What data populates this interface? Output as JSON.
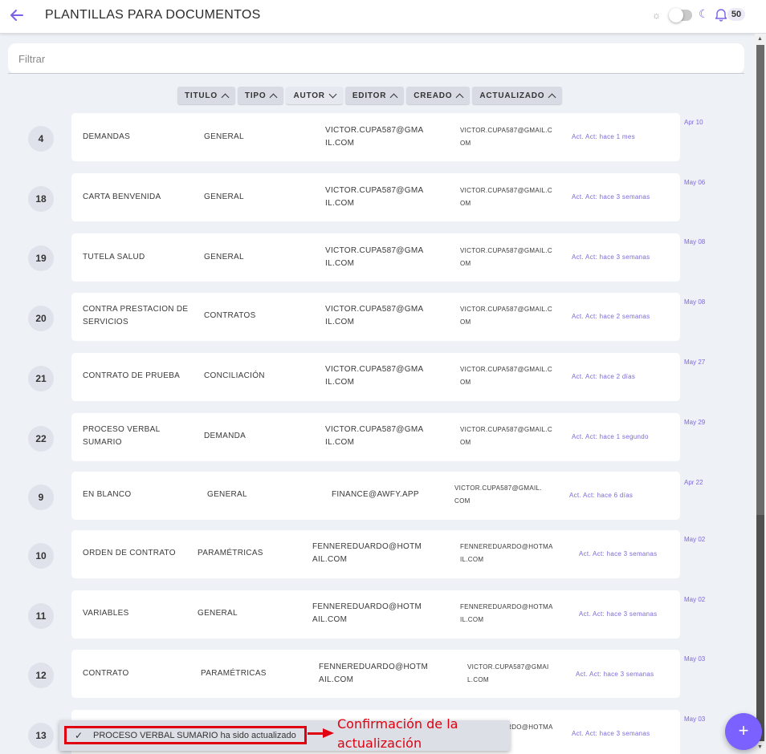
{
  "header": {
    "title": "PLANTILLAS PARA DOCUMENTOS",
    "notifications_count": "50"
  },
  "filter": {
    "placeholder": "Filtrar"
  },
  "sort_chips": [
    {
      "label": "TITULO",
      "direction": "up"
    },
    {
      "label": "TIPO",
      "direction": "up"
    },
    {
      "label": "AUTOR",
      "direction": "down"
    },
    {
      "label": "EDITOR",
      "direction": "up"
    },
    {
      "label": "CREADO",
      "direction": "up"
    },
    {
      "label": "ACTUALIZADO",
      "direction": "up"
    }
  ],
  "rows": [
    {
      "num": "4",
      "title": "DEMANDAS",
      "tipo": "GENERAL",
      "autor": "VICTOR.CUPA587@GMAIL.COM",
      "editor": "VICTOR.CUPA587@GMAIL.COM",
      "actualizado": "Act. Act: hace 1 mes",
      "creado": "Apr 10"
    },
    {
      "num": "18",
      "title": "CARTA BENVENIDA",
      "tipo": "GENERAL",
      "autor": "VICTOR.CUPA587@GMAIL.COM",
      "editor": "VICTOR.CUPA587@GMAIL.COM",
      "actualizado": "Act. Act: hace 3 semanas",
      "creado": "May 06"
    },
    {
      "num": "19",
      "title": "TUTELA SALUD",
      "tipo": "GENERAL",
      "autor": "VICTOR.CUPA587@GMAIL.COM",
      "editor": "VICTOR.CUPA587@GMAIL.COM",
      "actualizado": "Act. Act: hace 3 semanas",
      "creado": "May 08"
    },
    {
      "num": "20",
      "title": "CONTRA PRESTACION DE SERVICIOS",
      "tipo": "CONTRATOS",
      "autor": "VICTOR.CUPA587@GMAIL.COM",
      "editor": "VICTOR.CUPA587@GMAIL.COM",
      "actualizado": "Act. Act: hace 2 semanas",
      "creado": "May 08"
    },
    {
      "num": "21",
      "title": "CONTRATO DE PRUEBA",
      "tipo": "CONCILIACIÓN",
      "autor": "VICTOR.CUPA587@GMAIL.COM",
      "editor": "VICTOR.CUPA587@GMAIL.COM",
      "actualizado": "Act. Act: hace 2 días",
      "creado": "May 27"
    },
    {
      "num": "22",
      "title": "PROCESO VERBAL SUMARIO",
      "tipo": "DEMANDA",
      "autor": "VICTOR.CUPA587@GMAIL.COM",
      "editor": "VICTOR.CUPA587@GMAIL.COM",
      "actualizado": "Act. Act: hace 1 segundo",
      "creado": "May 29"
    },
    {
      "num": "9",
      "title": "EN BLANCO",
      "tipo": "GENERAL",
      "autor": "FINANCE@AWFY.APP",
      "editor": "VICTOR.CUPA587@GMAIL.COM",
      "actualizado": "Act. Act: hace 6 días",
      "creado": "Apr 22"
    },
    {
      "num": "10",
      "title": "ORDEN DE CONTRATO",
      "tipo": "PARAMÉTRICAS",
      "autor": "FENNEREDUARDO@HOTMAIL.COM",
      "editor": "FENNEREDUARDO@HOTMAIL.COM",
      "actualizado": "Act. Act: hace 3 semanas",
      "creado": "May 02"
    },
    {
      "num": "11",
      "title": "VARIABLES",
      "tipo": "GENERAL",
      "autor": "FENNEREDUARDO@HOTMAIL.COM",
      "editor": "FENNEREDUARDO@HOTMAIL.COM",
      "actualizado": "Act. Act: hace 3 semanas",
      "creado": "May 02"
    },
    {
      "num": "12",
      "title": "CONTRATO",
      "tipo": "PARAMÉTRICAS",
      "autor": "FENNEREDUARDO@HOTMAIL.COM",
      "editor": "VICTOR.CUPA587@GMAIL.COM",
      "actualizado": "Act. Act: hace 3 semanas",
      "creado": "May 03"
    },
    {
      "num": "13",
      "title": "",
      "tipo": "",
      "autor": "",
      "editor": "FENNEREDUARDO@HOTMAIL.COM",
      "actualizado": "Act. Act: hace 3 semanas",
      "creado": "May 03"
    }
  ],
  "toast": {
    "message": "PROCESO VERBAL SUMARIO ha sido actualizado"
  },
  "annotation": {
    "text": "Confirmación de la actualización",
    "color": "#e1000f"
  },
  "colors": {
    "accent": "#7b61ff",
    "background": "#eef1f6"
  },
  "icons": {
    "back": "arrow-left-icon",
    "theme_light": "sun-icon",
    "theme_dark": "moon-icon",
    "notifications": "bell-icon",
    "add": "plus-icon",
    "toast": "check-icon"
  }
}
